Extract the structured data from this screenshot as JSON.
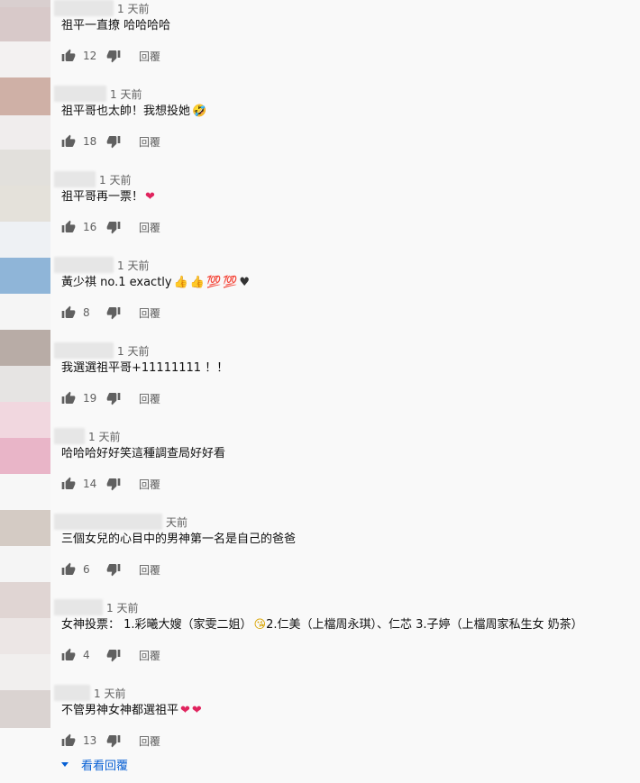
{
  "comments": [
    {
      "time": "1 天前",
      "text": "祖平一直撩 哈哈哈哈",
      "likes": "12",
      "reply": "回覆",
      "emojis": []
    },
    {
      "time": "1 天前",
      "text": "祖平哥也太帥！我想投她",
      "likes": "18",
      "reply": "回覆",
      "emojis": [
        "🤣"
      ]
    },
    {
      "time": "1 天前",
      "text": "祖平哥再一票！",
      "likes": "16",
      "reply": "回覆",
      "emojis": [
        "❤"
      ]
    },
    {
      "time": "1 天前",
      "text": "黃少祺 no.1 exactly",
      "likes": "8",
      "reply": "回覆",
      "emojis": [
        "👍",
        "👍",
        "💯",
        "💯",
        "♥"
      ]
    },
    {
      "time": "1 天前",
      "text": "我選選祖平哥+11111111 ！！",
      "likes": "19",
      "reply": "回覆",
      "emojis": []
    },
    {
      "time": "1 天前",
      "text": "哈哈哈好好笑這種調查局好好看",
      "likes": "14",
      "reply": "回覆",
      "emojis": []
    },
    {
      "time": "天前",
      "text": "三個女兒的心目中的男神第一名是自己的爸爸",
      "likes": "6",
      "reply": "回覆",
      "emojis": []
    },
    {
      "time": "1 天前",
      "text": "女神投票： 1.彩曦大嫂（家雯二姐）",
      "text_after": " 2.仁美（上檔周永琪）、仁芯 3.子婷（上檔周家私生女 奶茶）",
      "likes": "4",
      "reply": "回覆",
      "emojis": [
        "😘"
      ]
    },
    {
      "time": "1 天前",
      "text": "不管男神女神都選祖平",
      "likes": "13",
      "reply": "回覆",
      "emojis": [
        "❤",
        "❤"
      ]
    }
  ],
  "view_replies": "看看回覆",
  "colors": {
    "accent": "#065fd4",
    "muted": "#606060",
    "heart": "#e0245e"
  }
}
